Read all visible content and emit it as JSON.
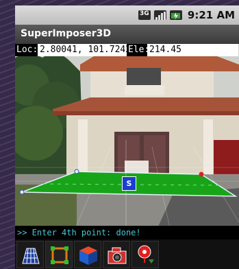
{
  "status_bar": {
    "time": "9:21 AM"
  },
  "app": {
    "title": "SuperImposer3D"
  },
  "readout": {
    "loc_label": "Loc:",
    "loc_value": "2.80041, 101.72421",
    "ele_label": "Ele:",
    "ele_value": "214.45"
  },
  "console": {
    "message": ">> Enter 4th point: done!"
  },
  "overlay": {
    "marker_label": "S"
  },
  "toolbar": {
    "tools": [
      "grid-perspective-icon",
      "select-box-icon",
      "cube-icon",
      "camera-icon",
      "location-marker-icon"
    ]
  }
}
